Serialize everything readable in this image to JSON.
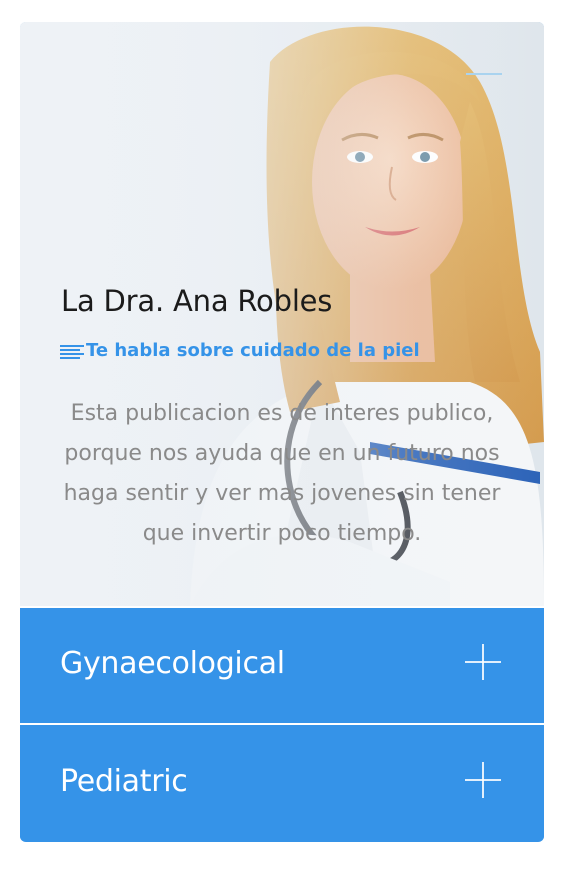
{
  "profile": {
    "name": "La Dra. Ana Robles",
    "subtitle": "Te habla sobre cuidado de la piel",
    "description": "Esta publicacion es de interes publico, porque nos ayuda que en un futuro nos haga sentir y ver mas jovenes sin tener que invertir poco tiempo.",
    "subtitle_icon": "lines-icon"
  },
  "accordion": {
    "items": [
      {
        "label": "Gynaecological",
        "icon": "plus-icon"
      },
      {
        "label": "Pediatric",
        "icon": "plus-icon"
      }
    ]
  },
  "colors": {
    "accent": "#3593e8",
    "text_dark": "#1b1b1b",
    "text_muted": "#8a8a8a",
    "background": "#e9eef3"
  }
}
